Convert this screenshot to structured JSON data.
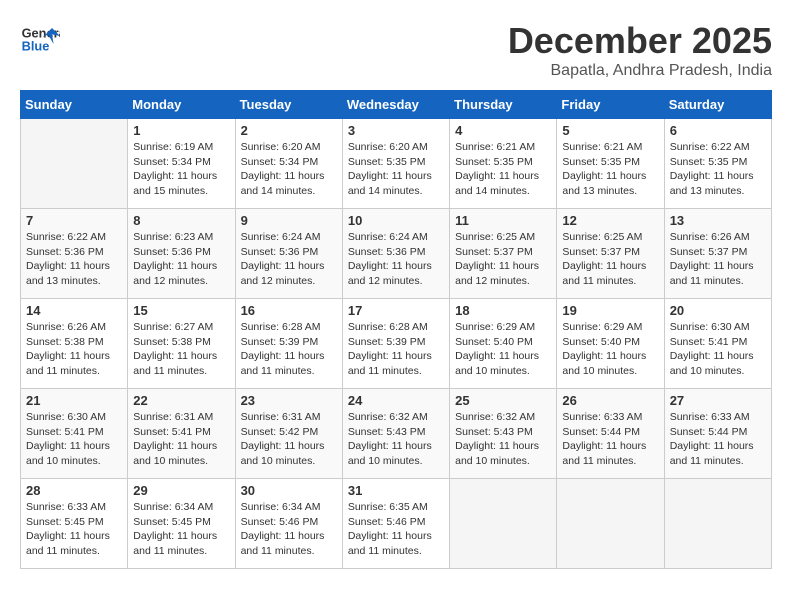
{
  "header": {
    "logo": "GeneralBlue",
    "month": "December 2025",
    "location": "Bapatla, Andhra Pradesh, India"
  },
  "weekdays": [
    "Sunday",
    "Monday",
    "Tuesday",
    "Wednesday",
    "Thursday",
    "Friday",
    "Saturday"
  ],
  "weeks": [
    [
      {
        "day": "",
        "info": ""
      },
      {
        "day": "1",
        "info": "Sunrise: 6:19 AM\nSunset: 5:34 PM\nDaylight: 11 hours\nand 15 minutes."
      },
      {
        "day": "2",
        "info": "Sunrise: 6:20 AM\nSunset: 5:34 PM\nDaylight: 11 hours\nand 14 minutes."
      },
      {
        "day": "3",
        "info": "Sunrise: 6:20 AM\nSunset: 5:35 PM\nDaylight: 11 hours\nand 14 minutes."
      },
      {
        "day": "4",
        "info": "Sunrise: 6:21 AM\nSunset: 5:35 PM\nDaylight: 11 hours\nand 14 minutes."
      },
      {
        "day": "5",
        "info": "Sunrise: 6:21 AM\nSunset: 5:35 PM\nDaylight: 11 hours\nand 13 minutes."
      },
      {
        "day": "6",
        "info": "Sunrise: 6:22 AM\nSunset: 5:35 PM\nDaylight: 11 hours\nand 13 minutes."
      }
    ],
    [
      {
        "day": "7",
        "info": "Sunrise: 6:22 AM\nSunset: 5:36 PM\nDaylight: 11 hours\nand 13 minutes."
      },
      {
        "day": "8",
        "info": "Sunrise: 6:23 AM\nSunset: 5:36 PM\nDaylight: 11 hours\nand 12 minutes."
      },
      {
        "day": "9",
        "info": "Sunrise: 6:24 AM\nSunset: 5:36 PM\nDaylight: 11 hours\nand 12 minutes."
      },
      {
        "day": "10",
        "info": "Sunrise: 6:24 AM\nSunset: 5:36 PM\nDaylight: 11 hours\nand 12 minutes."
      },
      {
        "day": "11",
        "info": "Sunrise: 6:25 AM\nSunset: 5:37 PM\nDaylight: 11 hours\nand 12 minutes."
      },
      {
        "day": "12",
        "info": "Sunrise: 6:25 AM\nSunset: 5:37 PM\nDaylight: 11 hours\nand 11 minutes."
      },
      {
        "day": "13",
        "info": "Sunrise: 6:26 AM\nSunset: 5:37 PM\nDaylight: 11 hours\nand 11 minutes."
      }
    ],
    [
      {
        "day": "14",
        "info": "Sunrise: 6:26 AM\nSunset: 5:38 PM\nDaylight: 11 hours\nand 11 minutes."
      },
      {
        "day": "15",
        "info": "Sunrise: 6:27 AM\nSunset: 5:38 PM\nDaylight: 11 hours\nand 11 minutes."
      },
      {
        "day": "16",
        "info": "Sunrise: 6:28 AM\nSunset: 5:39 PM\nDaylight: 11 hours\nand 11 minutes."
      },
      {
        "day": "17",
        "info": "Sunrise: 6:28 AM\nSunset: 5:39 PM\nDaylight: 11 hours\nand 11 minutes."
      },
      {
        "day": "18",
        "info": "Sunrise: 6:29 AM\nSunset: 5:40 PM\nDaylight: 11 hours\nand 10 minutes."
      },
      {
        "day": "19",
        "info": "Sunrise: 6:29 AM\nSunset: 5:40 PM\nDaylight: 11 hours\nand 10 minutes."
      },
      {
        "day": "20",
        "info": "Sunrise: 6:30 AM\nSunset: 5:41 PM\nDaylight: 11 hours\nand 10 minutes."
      }
    ],
    [
      {
        "day": "21",
        "info": "Sunrise: 6:30 AM\nSunset: 5:41 PM\nDaylight: 11 hours\nand 10 minutes."
      },
      {
        "day": "22",
        "info": "Sunrise: 6:31 AM\nSunset: 5:41 PM\nDaylight: 11 hours\nand 10 minutes."
      },
      {
        "day": "23",
        "info": "Sunrise: 6:31 AM\nSunset: 5:42 PM\nDaylight: 11 hours\nand 10 minutes."
      },
      {
        "day": "24",
        "info": "Sunrise: 6:32 AM\nSunset: 5:43 PM\nDaylight: 11 hours\nand 10 minutes."
      },
      {
        "day": "25",
        "info": "Sunrise: 6:32 AM\nSunset: 5:43 PM\nDaylight: 11 hours\nand 10 minutes."
      },
      {
        "day": "26",
        "info": "Sunrise: 6:33 AM\nSunset: 5:44 PM\nDaylight: 11 hours\nand 11 minutes."
      },
      {
        "day": "27",
        "info": "Sunrise: 6:33 AM\nSunset: 5:44 PM\nDaylight: 11 hours\nand 11 minutes."
      }
    ],
    [
      {
        "day": "28",
        "info": "Sunrise: 6:33 AM\nSunset: 5:45 PM\nDaylight: 11 hours\nand 11 minutes."
      },
      {
        "day": "29",
        "info": "Sunrise: 6:34 AM\nSunset: 5:45 PM\nDaylight: 11 hours\nand 11 minutes."
      },
      {
        "day": "30",
        "info": "Sunrise: 6:34 AM\nSunset: 5:46 PM\nDaylight: 11 hours\nand 11 minutes."
      },
      {
        "day": "31",
        "info": "Sunrise: 6:35 AM\nSunset: 5:46 PM\nDaylight: 11 hours\nand 11 minutes."
      },
      {
        "day": "",
        "info": ""
      },
      {
        "day": "",
        "info": ""
      },
      {
        "day": "",
        "info": ""
      }
    ]
  ]
}
